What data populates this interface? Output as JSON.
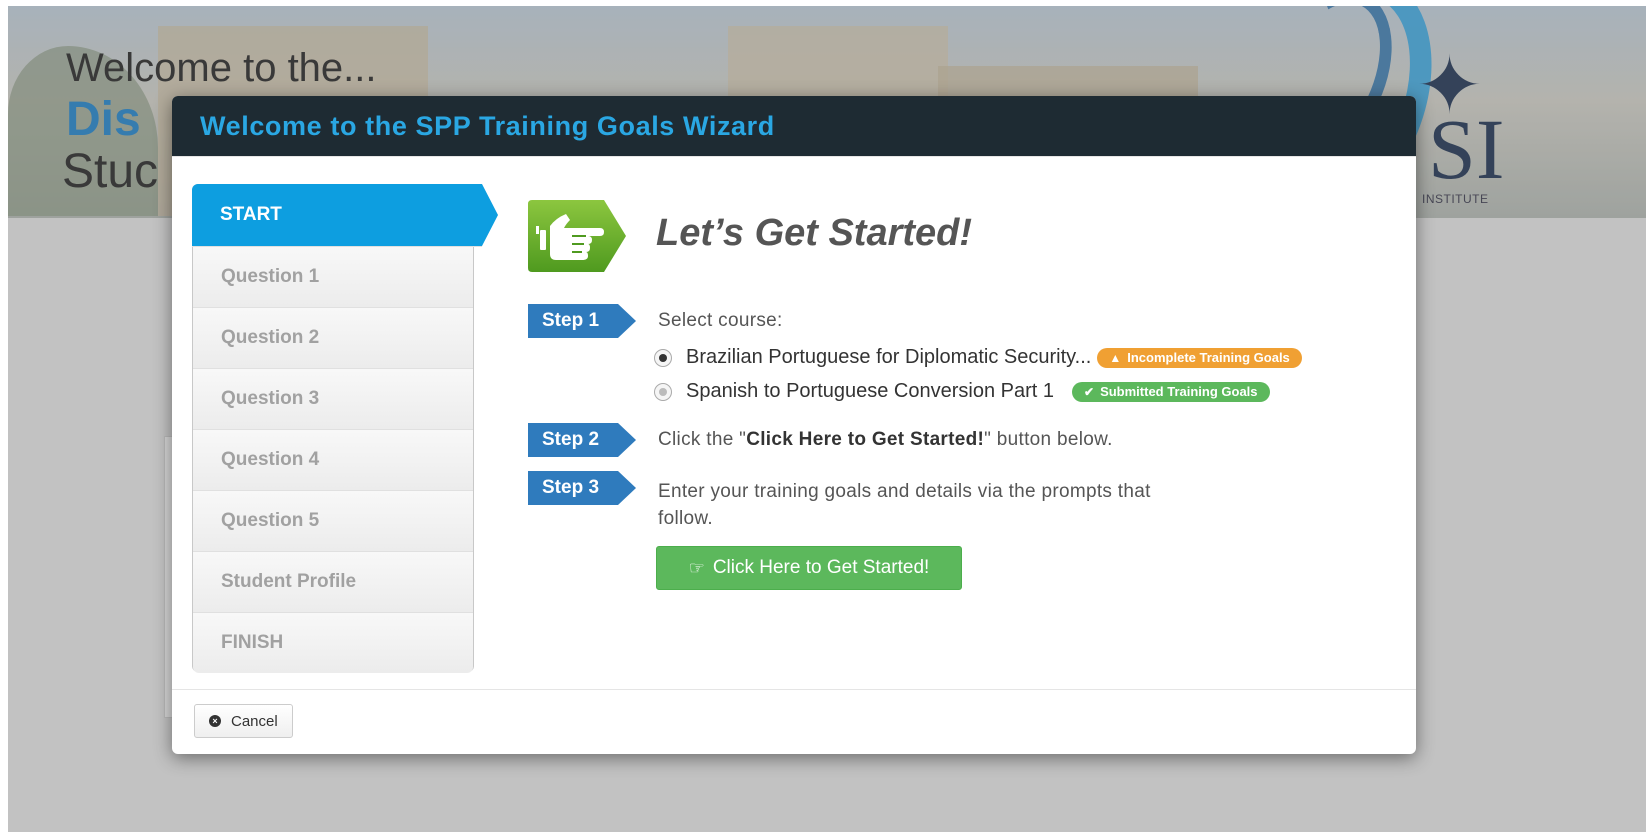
{
  "background": {
    "welcome": "Welcome to the...",
    "title_fragment": "Dis",
    "subtitle_fragment": "Stuc",
    "institute_fragment": "INSTITUTE"
  },
  "modal": {
    "title": "Welcome to the SPP Training Goals Wizard"
  },
  "steps": [
    {
      "label": "START",
      "active": true
    },
    {
      "label": "Question 1"
    },
    {
      "label": "Question 2"
    },
    {
      "label": "Question 3"
    },
    {
      "label": "Question 4"
    },
    {
      "label": "Question 5"
    },
    {
      "label": "Student Profile"
    },
    {
      "label": "FINISH"
    }
  ],
  "content": {
    "hero_title": "Let’s Get Started!",
    "step1": {
      "tag": "Step 1",
      "text": "Select course:"
    },
    "courses": [
      {
        "name": "Brazilian Portuguese for Diplomatic Security...",
        "selected": true,
        "badge": "Incomplete Training Goals",
        "badge_icon": "warning-icon"
      },
      {
        "name": "Spanish to Portuguese Conversion Part 1",
        "selected": false,
        "badge": "Submitted Training Goals",
        "badge_icon": "check-icon"
      }
    ],
    "step2": {
      "tag": "Step 2",
      "prefix": "Click the \"",
      "bold": "Click Here to Get Started!",
      "suffix": "\" button below."
    },
    "step3": {
      "tag": "Step 3",
      "line1": "Enter your training goals and details via the prompts that",
      "line2": "follow."
    },
    "start_button": "Click Here to Get Started!"
  },
  "footer": {
    "cancel_label": "Cancel"
  },
  "colors": {
    "header_bg": "#1e2b33",
    "title": "#2aa7e3",
    "active_step": "#0d9ee0",
    "step_tag": "#2f7bbd",
    "success": "#5cb85c",
    "warning": "#f0a033"
  }
}
